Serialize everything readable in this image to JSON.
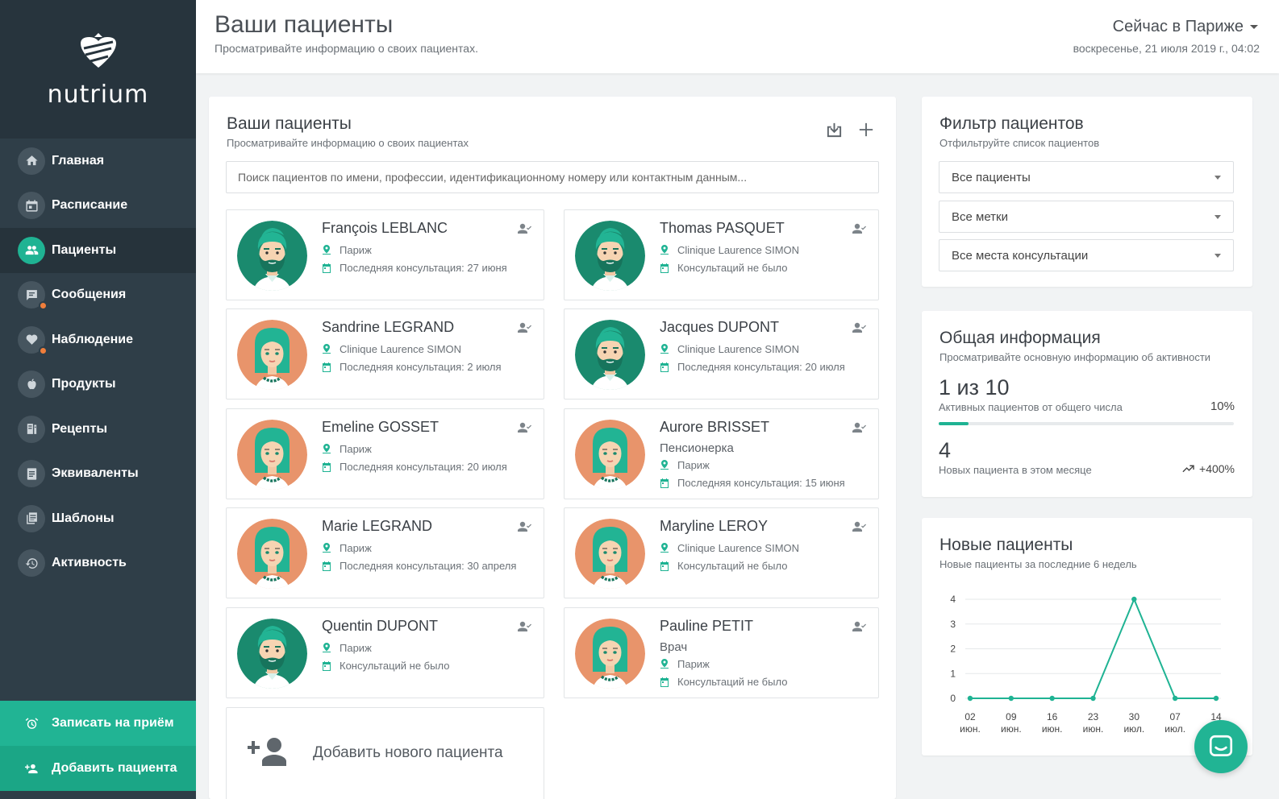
{
  "brand": {
    "name": "nutrium"
  },
  "nav": [
    {
      "label": "Главная",
      "icon": "home-icon",
      "active": false,
      "dot": false
    },
    {
      "label": "Расписание",
      "icon": "calendar-icon",
      "active": false,
      "dot": false
    },
    {
      "label": "Пациенты",
      "icon": "users-icon",
      "active": true,
      "dot": false
    },
    {
      "label": "Сообщения",
      "icon": "message-icon",
      "active": false,
      "dot": true
    },
    {
      "label": "Наблюдение",
      "icon": "heart-icon",
      "active": false,
      "dot": true
    },
    {
      "label": "Продукты",
      "icon": "apple-icon",
      "active": false,
      "dot": false
    },
    {
      "label": "Рецепты",
      "icon": "recipe-icon",
      "active": false,
      "dot": false
    },
    {
      "label": "Эквиваленты",
      "icon": "list-icon",
      "active": false,
      "dot": false
    },
    {
      "label": "Шаблоны",
      "icon": "template-icon",
      "active": false,
      "dot": false
    },
    {
      "label": "Активность",
      "icon": "history-icon",
      "active": false,
      "dot": false
    }
  ],
  "sidebar_actions": {
    "schedule": "Записать на приём",
    "add_patient": "Добавить пациента"
  },
  "header": {
    "title": "Ваши пациенты",
    "subtitle": "Просматривайте информацию о своих пациентах.",
    "timezone": "Сейчас в Париже",
    "datetime": "воскресенье, 21 июля 2019 г., 04:02"
  },
  "patients_panel": {
    "title": "Ваши пациенты",
    "subtitle": "Просматривайте информацию о своих пациентах",
    "search_placeholder": "Поиск пациентов по имени, профессии, идентификационному номеру или контактным данным...",
    "add_new": "Добавить нового пациента"
  },
  "patients": [
    {
      "name": "François LEBLANC",
      "gender": "male",
      "profession": "",
      "location": "Париж",
      "consult": "Последняя консультация: 27 июня"
    },
    {
      "name": "Thomas PASQUET",
      "gender": "male",
      "profession": "",
      "location": "Clinique Laurence SIMON",
      "consult": "Консультаций не было"
    },
    {
      "name": "Sandrine LEGRAND",
      "gender": "female",
      "profession": "",
      "location": "Clinique Laurence SIMON",
      "consult": "Последняя консультация: 2 июля"
    },
    {
      "name": "Jacques DUPONT",
      "gender": "male",
      "profession": "",
      "location": "Clinique Laurence SIMON",
      "consult": "Последняя консультация: 20 июля"
    },
    {
      "name": "Emeline GOSSET",
      "gender": "female",
      "profession": "",
      "location": "Париж",
      "consult": "Последняя консультация: 20 июля"
    },
    {
      "name": "Aurore BRISSET",
      "gender": "female",
      "profession": "Пенсионерка",
      "location": "Париж",
      "consult": "Последняя консультация: 15 июня"
    },
    {
      "name": "Marie LEGRAND",
      "gender": "female",
      "profession": "",
      "location": "Париж",
      "consult": "Последняя консультация: 30 апреля"
    },
    {
      "name": "Maryline LEROY",
      "gender": "female",
      "profession": "",
      "location": "Clinique Laurence SIMON",
      "consult": "Консультаций не было"
    },
    {
      "name": "Quentin DUPONT",
      "gender": "male",
      "profession": "",
      "location": "Париж",
      "consult": "Консультаций не было"
    },
    {
      "name": "Pauline PETIT",
      "gender": "female",
      "profession": "Врач",
      "location": "Париж",
      "consult": "Консультаций не было"
    }
  ],
  "filter": {
    "title": "Фильтр пациентов",
    "subtitle": "Отфильтруйте список пациентов",
    "selects": [
      "Все пациенты",
      "Все метки",
      "Все места консультации"
    ]
  },
  "info": {
    "title": "Общая информация",
    "subtitle": "Просматривайте основную информацию об активности",
    "active_count": "1 из 10",
    "active_label": "Активных пациентов от общего числа",
    "active_percent": "10%",
    "active_fraction": 0.1,
    "new_count": "4",
    "new_label": "Новых пациента в этом месяце",
    "new_change": "+400%"
  },
  "new_patients": {
    "title": "Новые пациенты",
    "subtitle": "Новые пациенты за последние 6 недель"
  },
  "chart_data": {
    "type": "line",
    "categories": [
      [
        "02",
        "июн."
      ],
      [
        "09",
        "июн."
      ],
      [
        "16",
        "июн."
      ],
      [
        "23",
        "июн."
      ],
      [
        "30",
        "июл."
      ],
      [
        "07",
        "июл."
      ],
      [
        "14",
        ""
      ]
    ],
    "values": [
      0,
      0,
      0,
      0,
      4,
      0,
      0
    ],
    "ylim": [
      0,
      4
    ],
    "yticks": [
      0,
      1,
      2,
      3,
      4
    ],
    "grid": true,
    "color": "#1fb393"
  },
  "colors": {
    "accent": "#1fb393",
    "sidebar": "#2f3e48",
    "avatar_male_bg": "#1a8a6e",
    "avatar_female_bg": "#e8946b",
    "notification": "#f07e3b"
  }
}
